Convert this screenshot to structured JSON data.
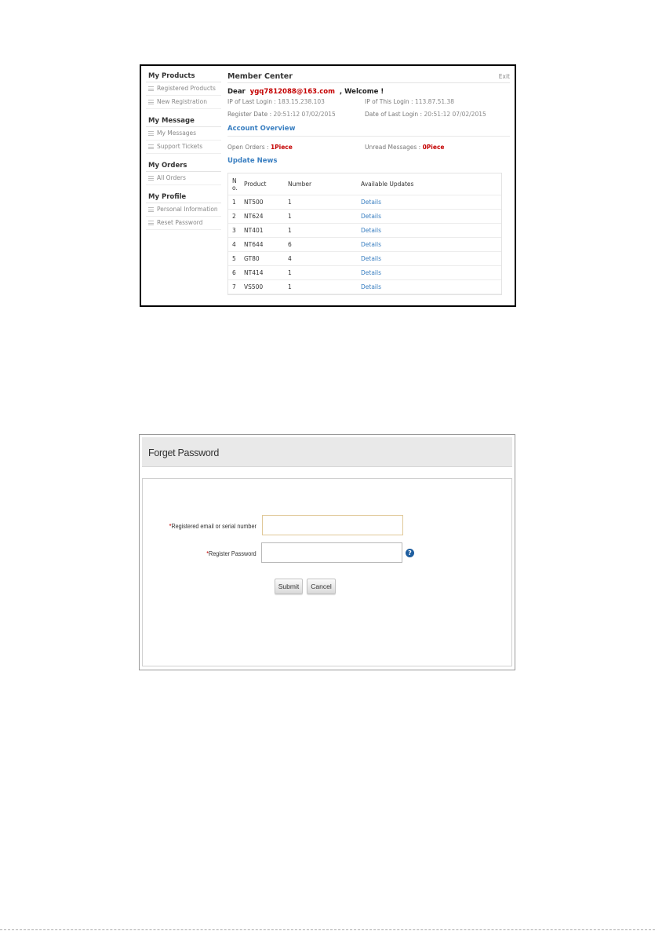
{
  "member_center": {
    "sidebar": [
      {
        "heading": "My Products",
        "items": [
          "Registered Products",
          "New Registration"
        ]
      },
      {
        "heading": "My Message",
        "items": [
          "My Messages",
          "Support Tickets"
        ]
      },
      {
        "heading": "My Orders",
        "items": [
          "All Orders"
        ]
      },
      {
        "heading": "My Profile",
        "items": [
          "Personal Information",
          "Reset Password"
        ]
      }
    ],
    "title": "Member Center",
    "exit_label": "Exit",
    "welcome_prefix": "Dear",
    "email": "ygq7812088@163.com",
    "welcome_suffix": ", Welcome !",
    "ip_last_label": "IP of Last Login : ",
    "ip_last": "183.15.238.103",
    "ip_this_label": "IP of This Login : ",
    "ip_this": "113.87.51.38",
    "register_date_label": "Register Date  : ",
    "register_date": "20:51:12 07/02/2015",
    "last_login_label": "Date of Last Login : ",
    "last_login": "20:51:12 07/02/2015",
    "account_overview": "Account Overview",
    "open_orders_label": "Open Orders : ",
    "open_orders": "1Piece",
    "unread_label": "Unread Messages : ",
    "unread": "0Piece",
    "update_news": "Update News",
    "table": {
      "headers": [
        "No.",
        "Product",
        "Number",
        "Available Updates"
      ],
      "rows": [
        {
          "no": "1",
          "product": "NT500",
          "number": "1",
          "link": "Details"
        },
        {
          "no": "2",
          "product": "NT624",
          "number": "1",
          "link": "Details"
        },
        {
          "no": "3",
          "product": "NT401",
          "number": "1",
          "link": "Details"
        },
        {
          "no": "4",
          "product": "NT644",
          "number": "6",
          "link": "Details"
        },
        {
          "no": "5",
          "product": "GT80",
          "number": "4",
          "link": "Details"
        },
        {
          "no": "6",
          "product": "NT414",
          "number": "1",
          "link": "Details"
        },
        {
          "no": "7",
          "product": "VS500",
          "number": "1",
          "link": "Details"
        }
      ]
    }
  },
  "forget_password": {
    "title": "Forget Password",
    "required_mark": "*",
    "email_label": "Registered email or serial number",
    "email_value": "",
    "password_label": "Register Password",
    "password_value": "",
    "help_symbol": "?",
    "submit_label": "Submit",
    "cancel_label": "Cancel"
  },
  "colors": {
    "accent_blue": "#3a7fc1",
    "alert_red": "#c40000",
    "help_icon": "#1f5e9f"
  }
}
